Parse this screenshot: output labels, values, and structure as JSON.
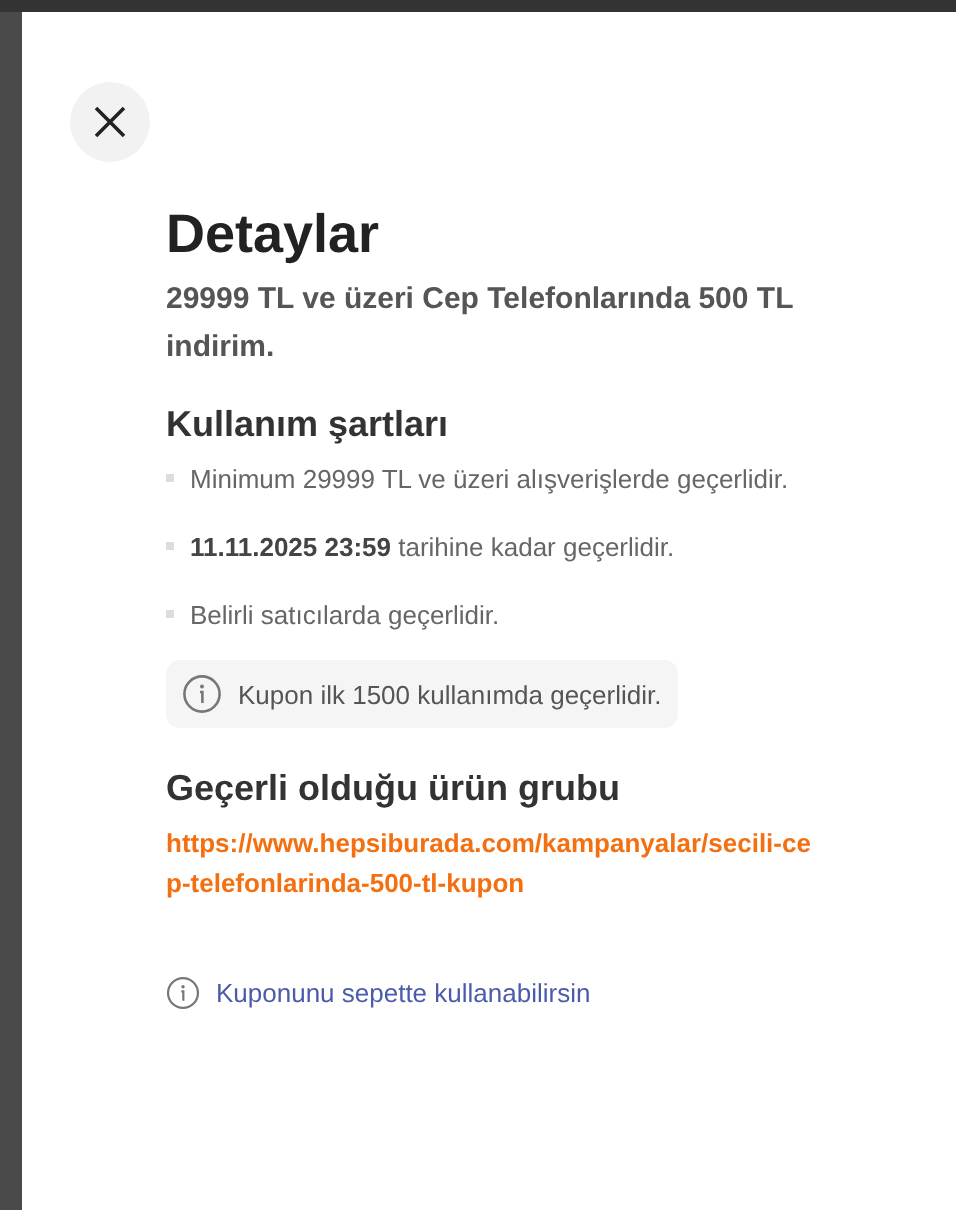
{
  "title": "Detaylar",
  "subtitle": "29999 TL ve üzeri Cep Telefonlarında 500 TL indirim.",
  "terms": {
    "heading": "Kullanım şartları",
    "items": [
      "Minimum 29999 TL ve üzeri alışverişlerde geçerlidir.",
      "**11.11.2025 23:59** tarihine kadar geçerlidir.",
      "Belirli satıcılarda geçerlidir."
    ],
    "notice": "Kupon ilk 1500 kullanımda geçerlidir."
  },
  "product_group": {
    "heading": "Geçerli olduğu ürün grubu",
    "link": "https://www.hepsiburada.com/kampanyalar/secili-cep-telefonlarinda-500-tl-kupon"
  },
  "footer_note": "Kuponunu sepette kullanabilirsin"
}
